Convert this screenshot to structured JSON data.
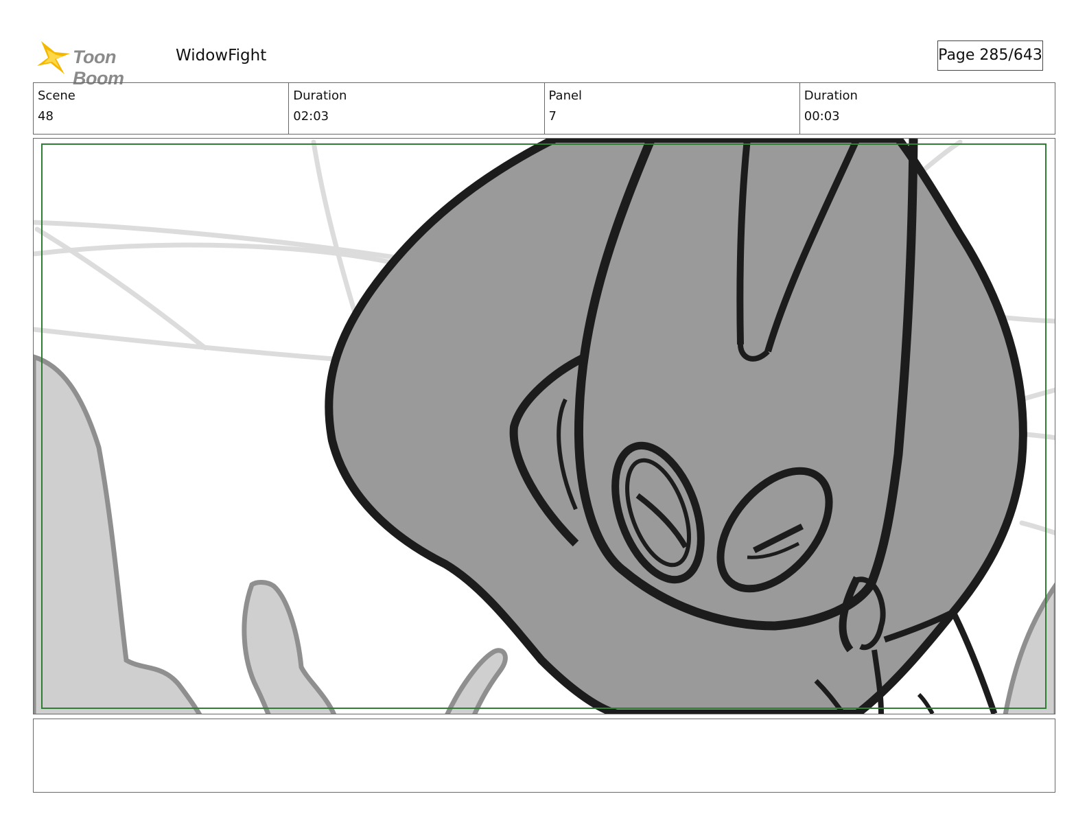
{
  "header": {
    "logo_text": "Toon Boom",
    "project_title": "WidowFight",
    "page_label": "Page 285/643"
  },
  "info": [
    {
      "label": "Scene",
      "value": "48"
    },
    {
      "label": "Duration",
      "value": "02:03"
    },
    {
      "label": "Panel",
      "value": "7"
    },
    {
      "label": "Duration",
      "value": "00:03"
    }
  ],
  "notes": {
    "text": ""
  },
  "colors": {
    "safe_frame": "#2e7d32",
    "shading": "#9a9a9a",
    "ink": "#1c1c1c"
  }
}
